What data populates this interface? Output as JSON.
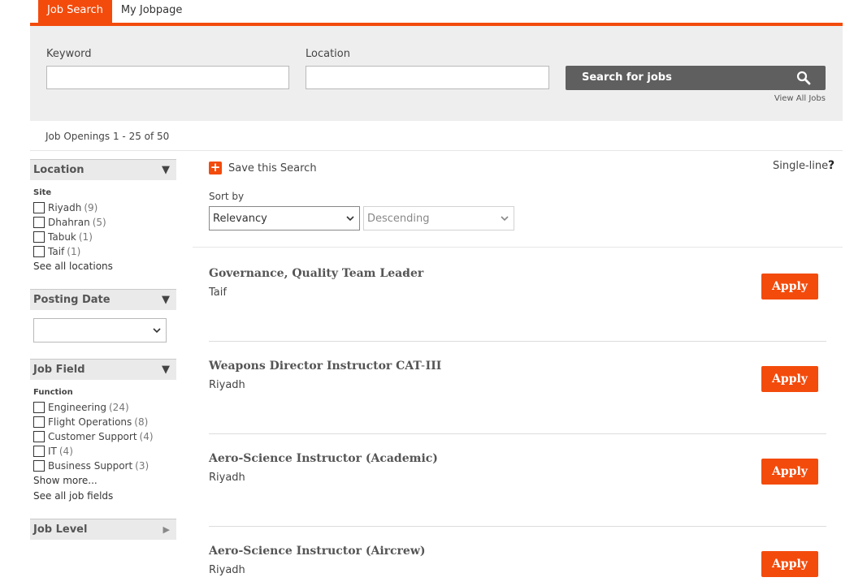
{
  "tabs": [
    {
      "label": "Job Search",
      "active": true
    },
    {
      "label": "My Jobpage",
      "active": false
    }
  ],
  "search": {
    "keyword_label": "Keyword",
    "keyword_value": "",
    "location_label": "Location",
    "location_value": "",
    "button_label": "Search for jobs",
    "view_all": "View All Jobs"
  },
  "results_summary": "Job Openings 1 - 25 of 50",
  "sidebar": {
    "location": {
      "title": "Location",
      "sub": "Site",
      "items": [
        {
          "label": "Riyadh",
          "count": "(9)"
        },
        {
          "label": "Dhahran",
          "count": "(5)"
        },
        {
          "label": "Tabuk",
          "count": "(1)"
        },
        {
          "label": "Taif",
          "count": "(1)"
        }
      ],
      "see_all": "See all locations"
    },
    "posting_date": {
      "title": "Posting Date",
      "selected": ""
    },
    "job_field": {
      "title": "Job Field",
      "sub": "Function",
      "items": [
        {
          "label": "Engineering",
          "count": "(24)"
        },
        {
          "label": "Flight Operations",
          "count": "(8)"
        },
        {
          "label": "Customer Support",
          "count": "(4)"
        },
        {
          "label": "IT",
          "count": "(4)"
        },
        {
          "label": "Business Support",
          "count": "(3)"
        }
      ],
      "show_more": "Show more...",
      "see_all": "See all job fields"
    },
    "job_level": {
      "title": "Job Level"
    }
  },
  "main": {
    "save_search": "Save this Search",
    "single_line": "Single-line",
    "help": "?",
    "sort_label": "Sort by",
    "sort_field": "Relevancy",
    "sort_order": "Descending",
    "apply_label": "Apply",
    "dash": "-",
    "jobs": [
      {
        "title": "Governance, Quality Team Leader",
        "location": "Taif"
      },
      {
        "title": "Weapons Director Instructor CAT III",
        "location": "Riyadh"
      },
      {
        "title": "Aero-Science Instructor (Academic)",
        "location": "Riyadh"
      },
      {
        "title": "Aero-Science Instructor (Aircrew)",
        "location": "Riyadh"
      }
    ]
  },
  "colors": {
    "accent": "#f34b0c",
    "search_button": "#5f5f5f",
    "panel": "#eeeeee"
  }
}
